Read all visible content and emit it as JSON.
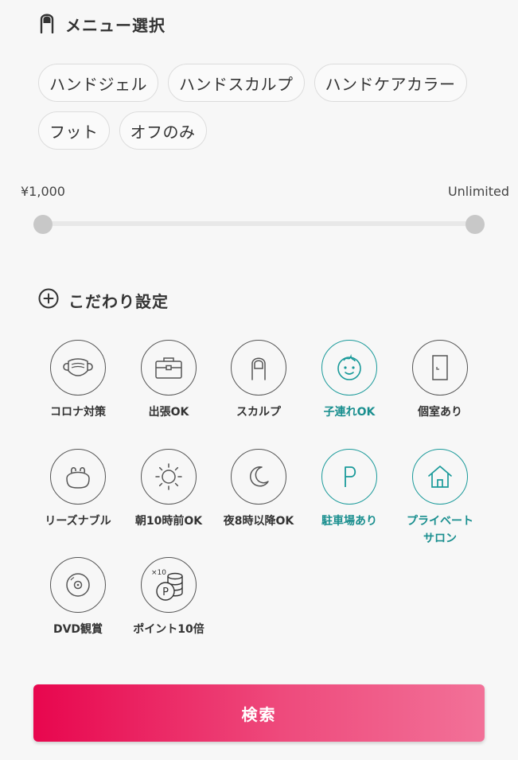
{
  "menu_section": {
    "title": "メニュー選択",
    "chips": [
      "ハンドジェル",
      "ハンドスカルプ",
      "ハンドケアカラー",
      "フット",
      "オフのみ"
    ]
  },
  "price_range": {
    "min_label": "¥1,000",
    "max_label": "Unlimited"
  },
  "kodawari_section": {
    "title": "こだわり設定"
  },
  "features": [
    {
      "label": "コロナ対策",
      "icon": "mask-icon",
      "active": false
    },
    {
      "label": "出張OK",
      "icon": "briefcase-icon",
      "active": false
    },
    {
      "label": "スカルプ",
      "icon": "nail-icon",
      "active": false
    },
    {
      "label": "子連れOK",
      "icon": "baby-face-icon",
      "active": true
    },
    {
      "label": "個室あり",
      "icon": "door-icon",
      "active": false
    },
    {
      "label": "リーズナブル",
      "icon": "coin-purse-icon",
      "active": false
    },
    {
      "label": "朝10時前OK",
      "icon": "sun-icon",
      "active": false
    },
    {
      "label": "夜8時以降OK",
      "icon": "moon-icon",
      "active": false
    },
    {
      "label": "駐車場あり",
      "icon": "parking-icon",
      "active": true
    },
    {
      "label": "プライベートサロン",
      "icon": "house-icon",
      "active": true
    },
    {
      "label": "DVD観賞",
      "icon": "disc-icon",
      "active": false
    },
    {
      "label": "ポイント10倍",
      "icon": "points-coin-icon",
      "active": false,
      "badge": "×10",
      "mark": "P"
    }
  ],
  "search_button": {
    "label": "検索"
  },
  "colors": {
    "accent_teal": "#1a9a9a",
    "button_pink_start": "#e8064e",
    "button_pink_end": "#f27198"
  }
}
